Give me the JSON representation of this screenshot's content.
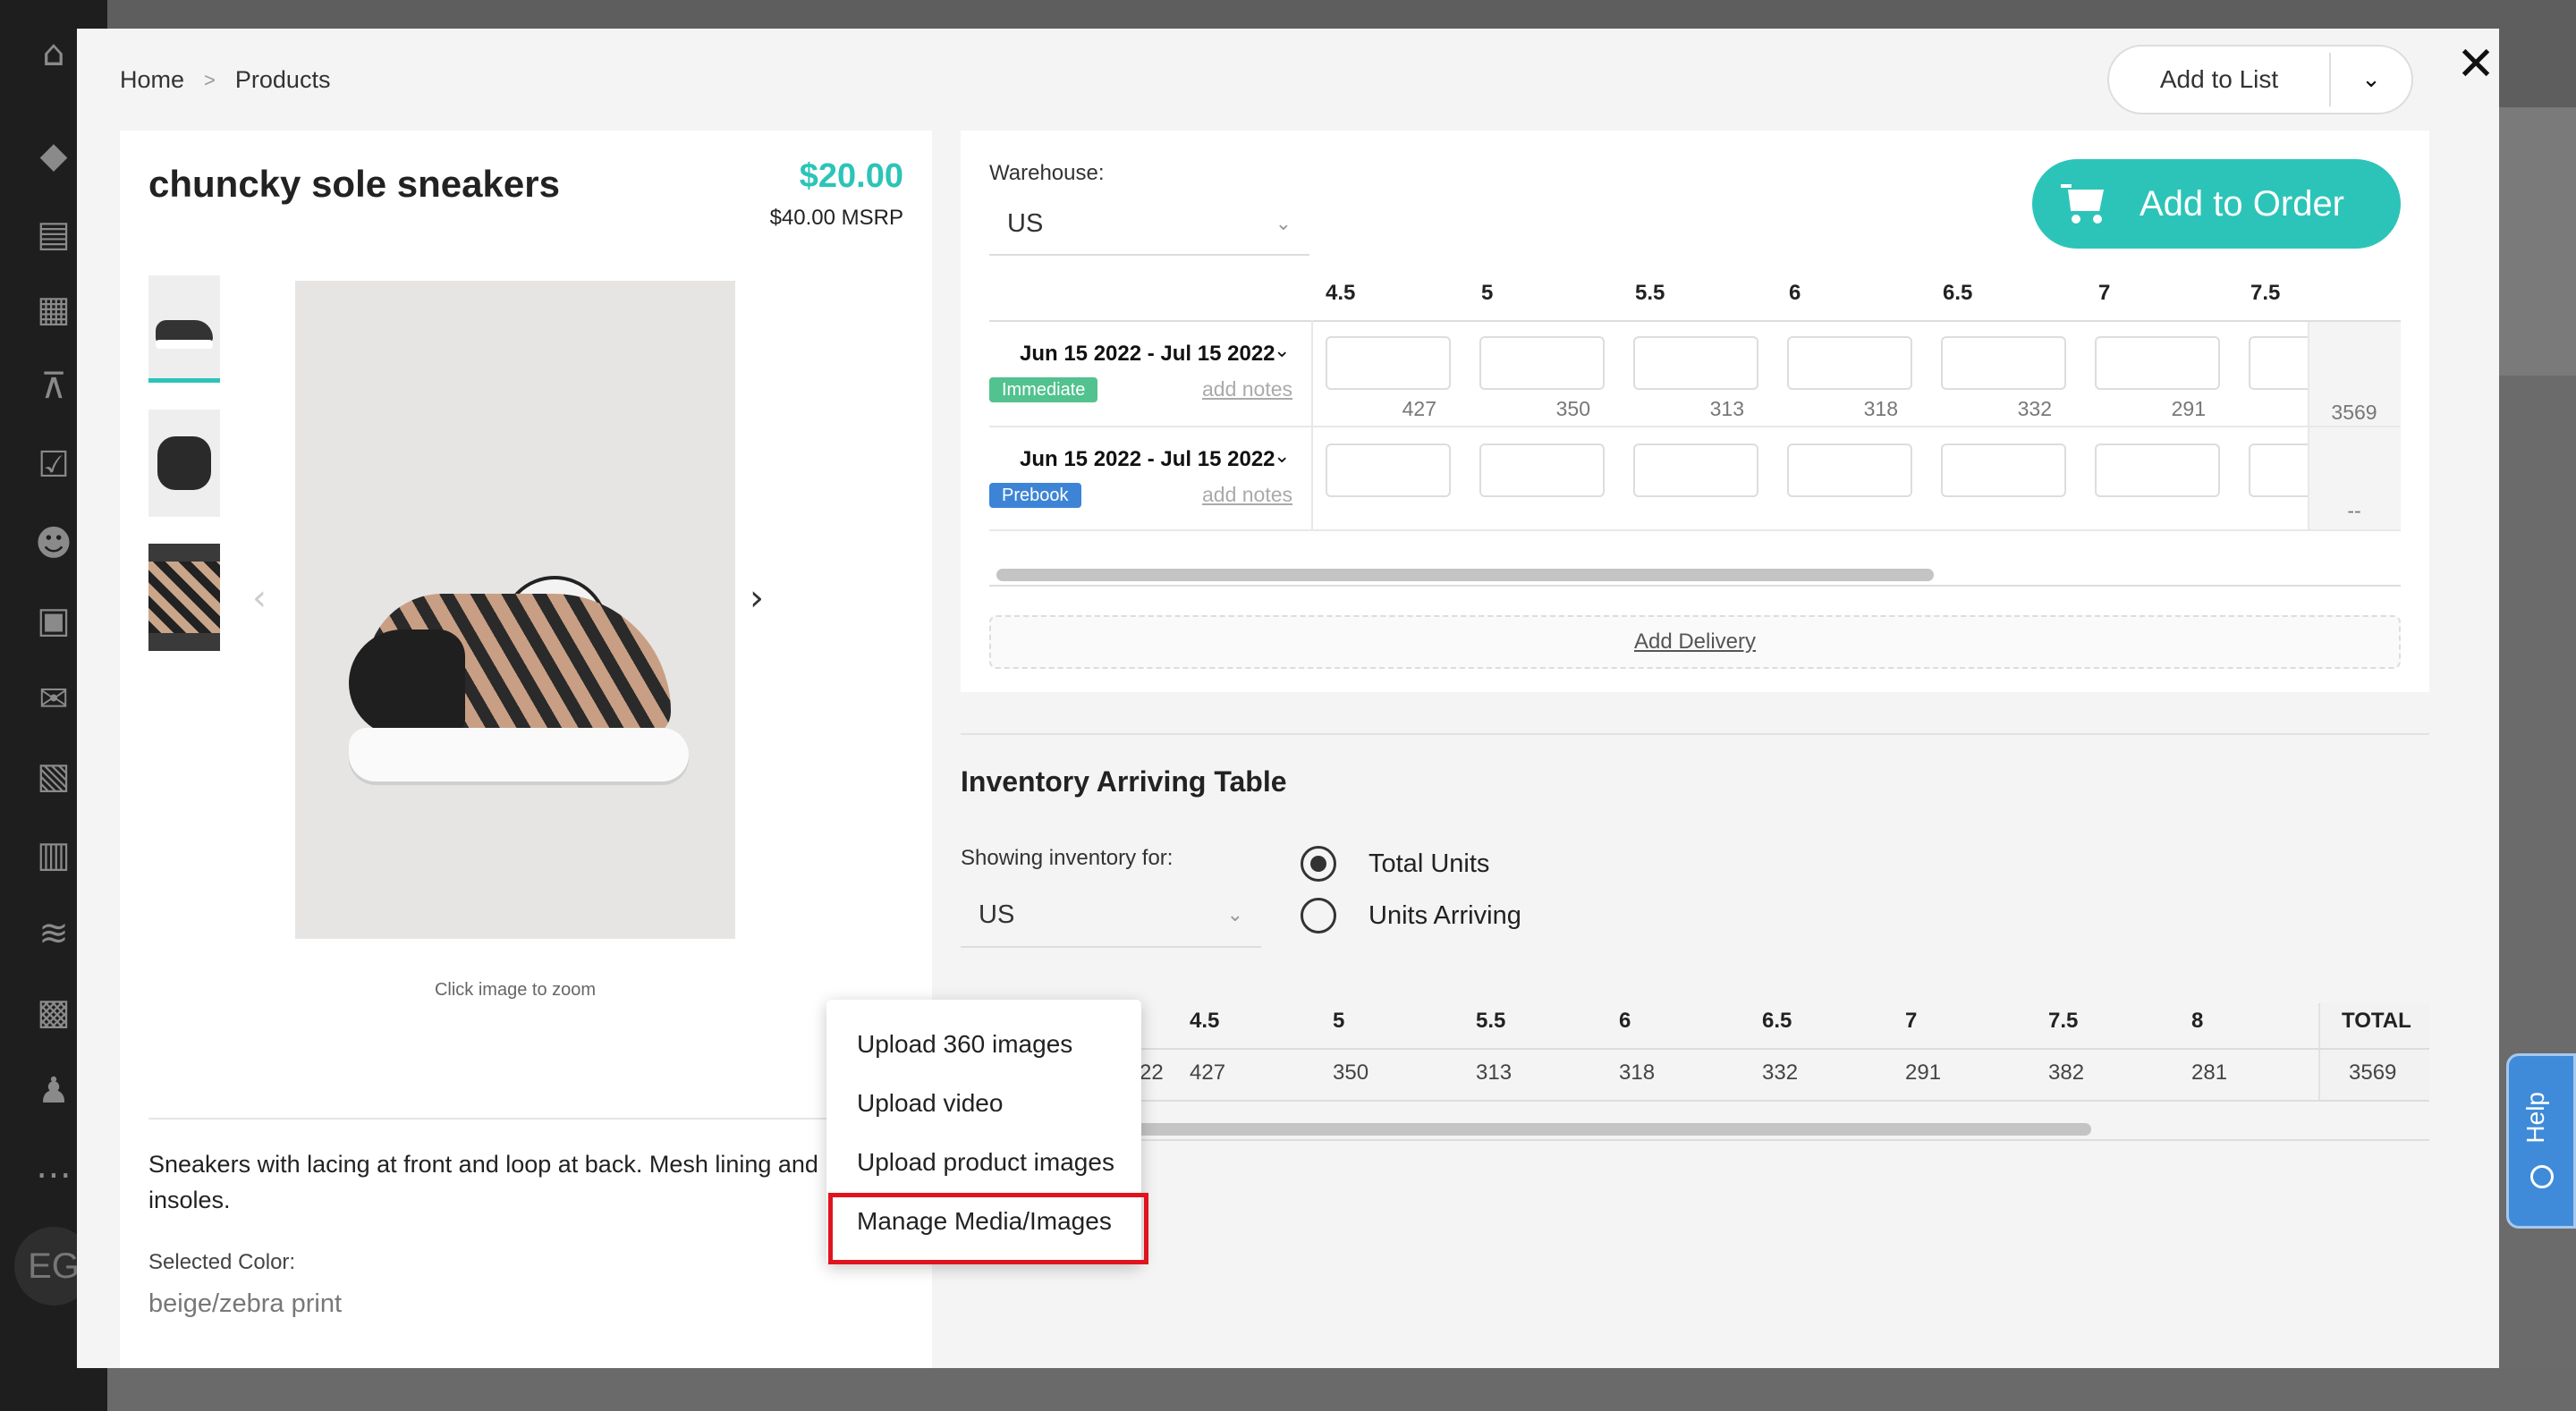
{
  "breadcrumb": {
    "home": "Home",
    "separator": ">",
    "current": "Products"
  },
  "header": {
    "add_to_list": "Add to List",
    "close": "✕"
  },
  "product": {
    "title": "chuncky sole sneakers",
    "price": "$20.00",
    "msrp": "$40.00 MSRP",
    "zoom_hint": "Click image to zoom",
    "description": "Sneakers with lacing at front and loop at back. Mesh lining and insoles.",
    "selected_color_label": "Selected Color:",
    "selected_color": "beige/zebra print"
  },
  "order": {
    "warehouse_label": "Warehouse:",
    "warehouse": "US",
    "add_to_order": "Add to Order",
    "sizes": [
      "4.5",
      "5",
      "5.5",
      "6",
      "6.5",
      "7",
      "7.5"
    ],
    "deliveries": [
      {
        "dates": "Jun 15 2022 - Jul 15 2022",
        "badge": "Immediate",
        "notes": "add notes",
        "available": [
          "427",
          "350",
          "313",
          "318",
          "332",
          "291"
        ],
        "total": "3569"
      },
      {
        "dates": "Jun 15 2022 - Jul 15 2022",
        "badge": "Prebook",
        "notes": "add notes",
        "available": [],
        "total": "--"
      }
    ],
    "add_delivery": "Add Delivery"
  },
  "inventory": {
    "title": "Inventory Arriving Table",
    "showing_label": "Showing inventory for:",
    "warehouse": "US",
    "options": [
      "Total Units",
      "Units Arriving"
    ],
    "selected_option": "Total Units",
    "headers": [
      "4.5",
      "5",
      "5.5",
      "6",
      "6.5",
      "7",
      "7.5",
      "8",
      "TOTAL"
    ],
    "row_date_fragment": "22",
    "row": [
      "427",
      "350",
      "313",
      "318",
      "332",
      "291",
      "382",
      "281",
      "3569"
    ]
  },
  "context_menu": {
    "items": [
      "Upload 360 images",
      "Upload video",
      "Upload product images",
      "Manage Media/Images"
    ],
    "highlighted": "Manage Media/Images"
  },
  "help": {
    "label": "Help"
  },
  "avatar": {
    "initials": "EG"
  },
  "colors": {
    "accent": "#2cc4b8",
    "immediate": "#52c28e",
    "prebook": "#3d84d6",
    "highlight": "#e0141e",
    "help": "#3f8bd9"
  }
}
